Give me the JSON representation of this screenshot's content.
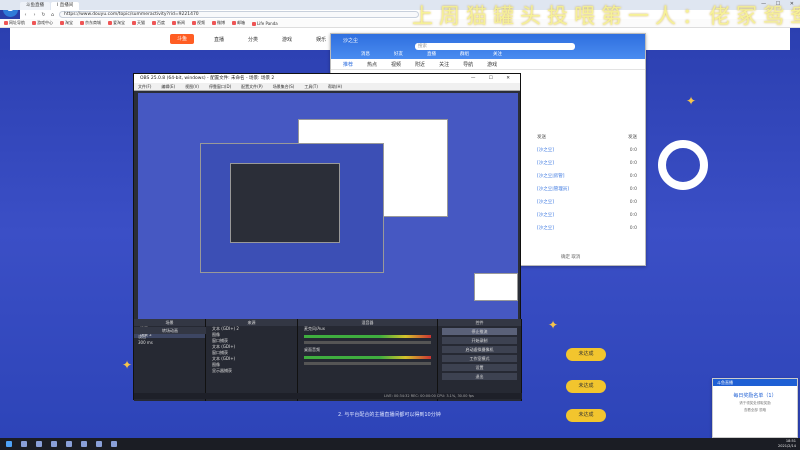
{
  "browser": {
    "tabs": [
      "斗鱼直播",
      "Ⅰ 直播间"
    ],
    "address": "https://www.douyu.com/topic/summeractivity?rid=9221470",
    "bookmarks": [
      "网址导航",
      "游戏中心",
      "淘宝",
      "京东商城",
      "爱淘宝",
      "天猫",
      "百度",
      "新闻",
      "视频",
      "微博",
      "邮箱",
      "Life Panda"
    ]
  },
  "site": {
    "logo": "斗鱼",
    "nav": [
      "首页",
      "直播",
      "分类",
      "游戏",
      "娱乐"
    ],
    "task_text": "2. 与平台配合的主播直播间都可以得到10分钟",
    "buttons": [
      "未达成",
      "未达成",
      "未达成"
    ]
  },
  "overlay": {
    "title": "上周猫罐头投喂第一人：佬冢鸳鸯"
  },
  "popup": {
    "title": "沙之尘",
    "search": "搜索",
    "tabs": [
      "消息",
      "好友",
      "直播",
      "群组",
      "关注"
    ],
    "menu": [
      "推荐",
      "热点",
      "视频",
      "附近",
      "关注",
      "导航",
      "游戏"
    ],
    "rows": [
      {
        "label": "发送",
        "value": "发送"
      },
      {
        "label": "[沙之尘]",
        "value": "0:0"
      },
      {
        "label": "[沙之尘]",
        "value": "0:0"
      },
      {
        "label": "[沙之尘|房管]",
        "value": "0:0"
      },
      {
        "label": "[沙之尘|管理员]",
        "value": "0:0"
      },
      {
        "label": "[沙之尘]",
        "value": "0:0"
      },
      {
        "label": "[沙之尘]",
        "value": "0:0"
      },
      {
        "label": "[沙之尘]",
        "value": "0:0"
      }
    ],
    "footer": "确定  取消"
  },
  "obs": {
    "title": "OBS 25.0.8 (64-bit, windows) - 配置文件: 未命名 - 场景: 场景 2",
    "menu": [
      "文件(F)",
      "编辑(E)",
      "视图(V)",
      "停靠窗口(D)",
      "配置文件(P)",
      "场景集合(S)",
      "工具(T)",
      "帮助(H)"
    ],
    "docks": {
      "scenes": "场景",
      "sources": "来源",
      "mixer": "混音器",
      "transitions": "转场动画",
      "controls": "控件"
    },
    "scene_items": [
      "场景",
      "场景 2"
    ],
    "source_items": [
      "文本 (GDI+) 2",
      "图像",
      "窗口捕获",
      "文本 (GDI+)",
      "窗口捕获",
      "文本 (GDI+)",
      "图像",
      "显示器捕获"
    ],
    "mixer_items": [
      "麦克风/Aux",
      "桌面音频"
    ],
    "transition_value": "淡出",
    "transition_duration": "300 ms",
    "control_buttons": [
      "停止推流",
      "开始录制",
      "启动虚拟摄像机",
      "工作室模式",
      "设置",
      "退出"
    ],
    "status": "LIVE: 00:34:32   REC: 00:00:00   CPU: 3.1%, 30.00 fps"
  },
  "toast": {
    "head": "斗鱼直播",
    "title": "每日奖励名单（1）",
    "lines": [
      "请于领奖处领取奖励",
      "查看全部  忽略"
    ]
  },
  "taskbar": {
    "time": "18:51",
    "date": "2021/2/14"
  }
}
